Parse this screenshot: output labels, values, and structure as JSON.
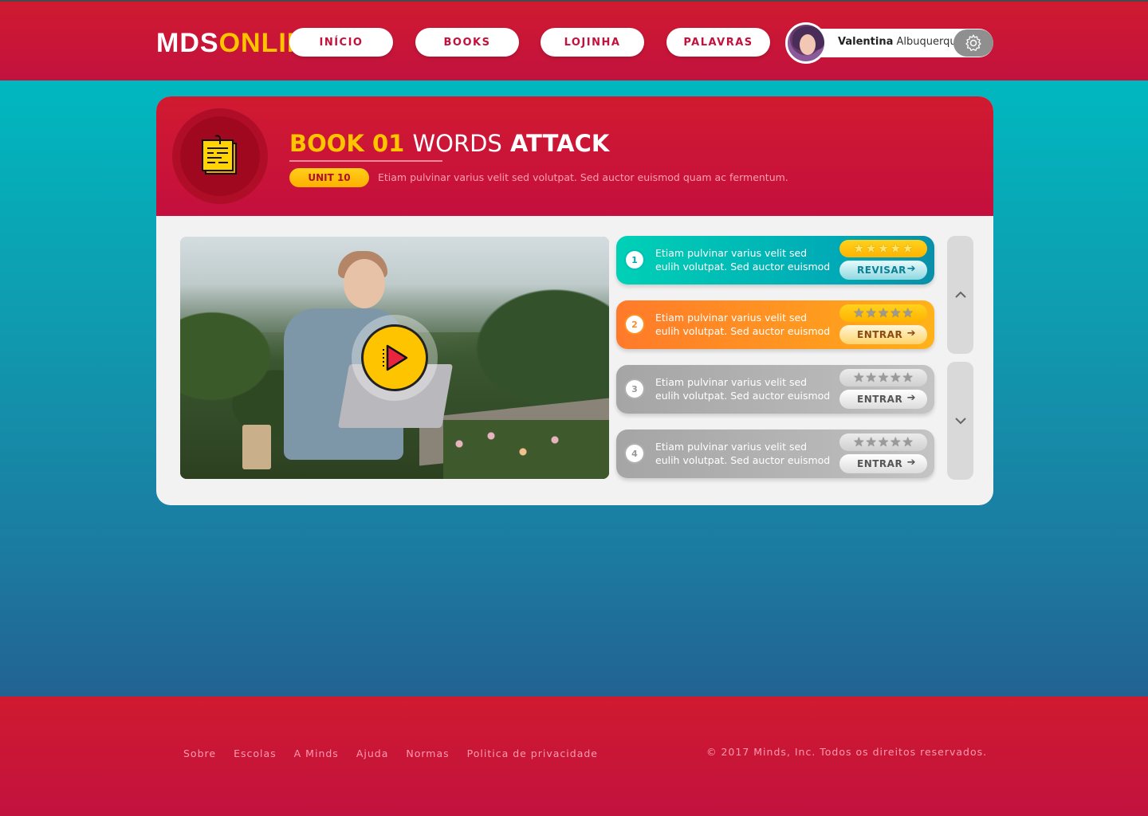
{
  "header": {
    "logo": {
      "part1": "MDS",
      "part2": "ONLINE"
    },
    "nav": [
      {
        "label": "INÍCIO"
      },
      {
        "label": "BOOKS"
      },
      {
        "label": "LOJINHA"
      },
      {
        "label": "PALAVRAS"
      }
    ],
    "user": {
      "first_name": "Valentina",
      "last_name": "Albuquerque"
    }
  },
  "book": {
    "title_number": "BOOK 01",
    "title_word1": "WORDS",
    "title_word2": "ATTACK",
    "unit": "UNIT 10",
    "description": "Etiam pulvinar varius velit sed volutpat. Sed auctor euismod quam ac fermentum."
  },
  "lessons": [
    {
      "number": "1",
      "text": "Etiam pulvinar varius velit sed eulih volutpat. Sed auctor euismod",
      "button": "REVISAR",
      "stars_filled": 5,
      "stars_total": 5,
      "state": "completed"
    },
    {
      "number": "2",
      "text": "Etiam pulvinar varius velit sed eulih volutpat. Sed auctor euismod",
      "button": "ENTRAR",
      "stars_filled": 0,
      "stars_total": 5,
      "state": "current"
    },
    {
      "number": "3",
      "text": "Etiam pulvinar varius velit sed eulih volutpat. Sed auctor euismod",
      "button": "ENTRAR",
      "stars_filled": 0,
      "stars_total": 5,
      "state": "locked"
    },
    {
      "number": "4",
      "text": "Etiam pulvinar varius velit sed eulih volutpat. Sed auctor euismod",
      "button": "ENTRAR",
      "stars_filled": 0,
      "stars_total": 5,
      "state": "locked"
    }
  ],
  "footer": {
    "links": [
      {
        "label": "Sobre"
      },
      {
        "label": "Escolas"
      },
      {
        "label": "A Minds"
      },
      {
        "label": "Ajuda"
      },
      {
        "label": "Normas"
      },
      {
        "label": "Politica de privacidade"
      }
    ],
    "copyright": "© 2017 Minds, Inc. Todos os direitos reservados."
  },
  "colors": {
    "brand_red": "#c8163a",
    "accent_yellow": "#ffc400",
    "teal": "#00b8bf",
    "orange": "#ff8a20",
    "gray": "#b0b0b0"
  },
  "icons": {
    "settings": "gear-icon",
    "book_badge": "notebook-icon",
    "play": "play-icon",
    "arrow": "arrow-right-icon",
    "scroll_up": "chevron-up-icon",
    "scroll_down": "chevron-down-icon"
  }
}
